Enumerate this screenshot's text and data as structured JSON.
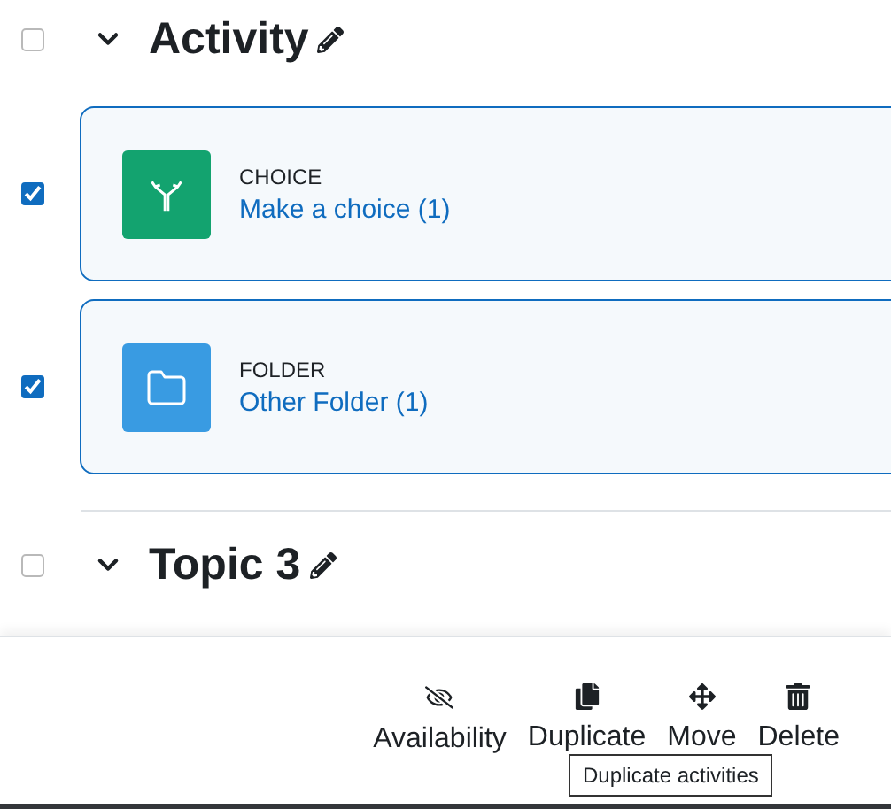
{
  "sections": [
    {
      "title": "Activity",
      "checked": false,
      "activities": [
        {
          "kind": "choice",
          "type": "CHOICE",
          "name": "Make a choice (1)",
          "checked": true
        },
        {
          "kind": "folder",
          "type": "FOLDER",
          "name": "Other Folder (1)",
          "checked": true
        }
      ]
    },
    {
      "title": "Topic 3",
      "checked": false
    }
  ],
  "bulk_actions": [
    {
      "kind": "availability",
      "label": "Availability"
    },
    {
      "kind": "duplicate",
      "label": "Duplicate"
    },
    {
      "kind": "move",
      "label": "Move"
    },
    {
      "kind": "delete",
      "label": "Delete"
    }
  ],
  "tooltip": "Duplicate activities"
}
